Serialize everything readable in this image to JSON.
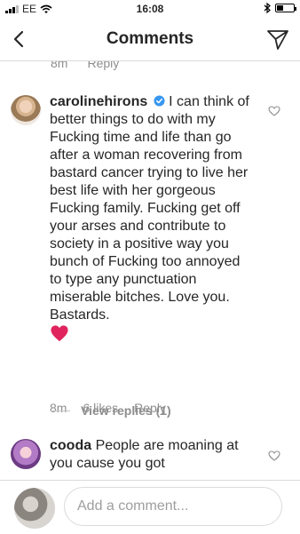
{
  "status_bar": {
    "carrier": "EE",
    "time": "16:08"
  },
  "header": {
    "title": "Comments",
    "back_icon": "chevron-left-icon",
    "share_icon": "paper-plane-icon"
  },
  "previous_comment": {
    "time": "8m",
    "reply": "Reply"
  },
  "comments": [
    {
      "username": "carolinehirons",
      "verified": true,
      "text": " I can think of better things to do with my Fucking time and life than go after a woman recovering from bastard cancer trying to live her best life with her gorgeous Fucking family. Fucking get off your arses and contribute to society in a positive way you bunch of Fucking too annoyed to type any punctuation miserable bitches. Love you. Bastards.",
      "emoji": "red-heart",
      "time": "8m",
      "likes": "6 likes",
      "reply": "Reply",
      "view_replies": "View replies (1)"
    },
    {
      "username": "cooda",
      "text": " People are moaning at you cause you got"
    }
  ],
  "input_bar": {
    "placeholder": "Add a comment..."
  },
  "colors": {
    "text": "#262626",
    "secondary": "#8e8e8e",
    "verified": "#3897f0",
    "heart": "#e0245e",
    "divider": "#dbdbdb"
  }
}
